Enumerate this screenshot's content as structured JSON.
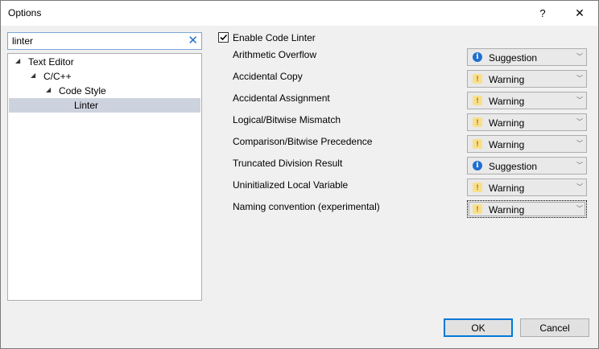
{
  "window": {
    "title": "Options",
    "help_label": "?",
    "close_label": "✕"
  },
  "search": {
    "value": "linter",
    "clear_label": "✕"
  },
  "tree": {
    "items": [
      {
        "label": "Text Editor",
        "expanded": true,
        "selected": false
      },
      {
        "label": "C/C++",
        "expanded": true,
        "selected": false
      },
      {
        "label": "Code Style",
        "expanded": true,
        "selected": false
      },
      {
        "label": "Linter",
        "expanded": false,
        "selected": true
      }
    ]
  },
  "linter": {
    "enable_label": "Enable Code Linter",
    "enabled": true,
    "rules": [
      {
        "name": "Arithmetic Overflow",
        "severity": "Suggestion",
        "icon": "info-icon"
      },
      {
        "name": "Accidental Copy",
        "severity": "Warning",
        "icon": "warning-icon"
      },
      {
        "name": "Accidental Assignment",
        "severity": "Warning",
        "icon": "warning-icon"
      },
      {
        "name": "Logical/Bitwise Mismatch",
        "severity": "Warning",
        "icon": "warning-icon"
      },
      {
        "name": "Comparison/Bitwise Precedence",
        "severity": "Warning",
        "icon": "warning-icon"
      },
      {
        "name": "Truncated Division Result",
        "severity": "Suggestion",
        "icon": "info-icon"
      },
      {
        "name": "Uninitialized Local Variable",
        "severity": "Warning",
        "icon": "warning-icon"
      },
      {
        "name": "Naming convention (experimental)",
        "severity": "Warning",
        "icon": "warning-icon"
      }
    ]
  },
  "buttons": {
    "ok": "OK",
    "cancel": "Cancel"
  },
  "colors": {
    "accent": "#0078d7",
    "info": "#1e6fd0",
    "warning_bg": "#f8e08a",
    "selection": "#cdd3de"
  }
}
